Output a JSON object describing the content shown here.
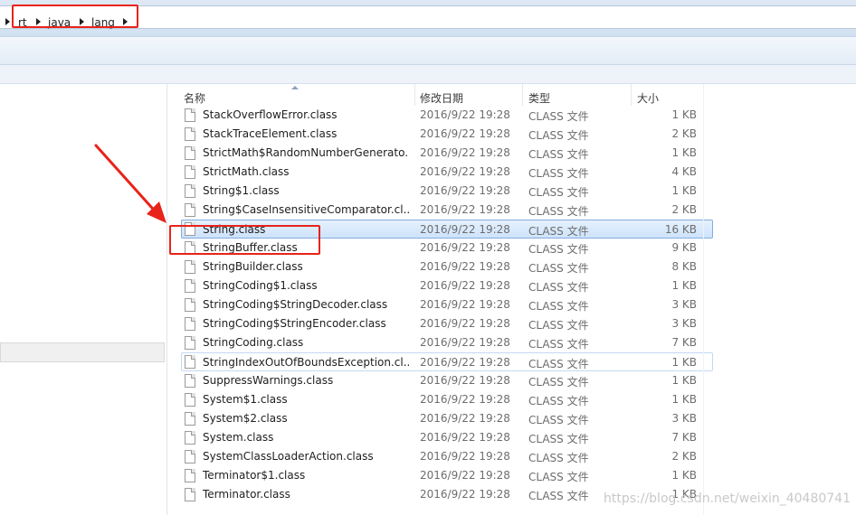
{
  "breadcrumb": [
    "rt",
    "java",
    "lang"
  ],
  "columns": {
    "name": "名称",
    "date": "修改日期",
    "type": "类型",
    "size": "大小"
  },
  "files": [
    {
      "name": "StackOverflowError.class",
      "date": "2016/9/22 19:28",
      "type": "CLASS 文件",
      "size": "1 KB"
    },
    {
      "name": "StackTraceElement.class",
      "date": "2016/9/22 19:28",
      "type": "CLASS 文件",
      "size": "2 KB"
    },
    {
      "name": "StrictMath$RandomNumberGenerato...",
      "date": "2016/9/22 19:28",
      "type": "CLASS 文件",
      "size": "1 KB"
    },
    {
      "name": "StrictMath.class",
      "date": "2016/9/22 19:28",
      "type": "CLASS 文件",
      "size": "4 KB"
    },
    {
      "name": "String$1.class",
      "date": "2016/9/22 19:28",
      "type": "CLASS 文件",
      "size": "1 KB"
    },
    {
      "name": "String$CaseInsensitiveComparator.cl...",
      "date": "2016/9/22 19:28",
      "type": "CLASS 文件",
      "size": "2 KB"
    },
    {
      "name": "String.class",
      "date": "2016/9/22 19:28",
      "type": "CLASS 文件",
      "size": "16 KB",
      "state": "selected"
    },
    {
      "name": "StringBuffer.class",
      "date": "2016/9/22 19:28",
      "type": "CLASS 文件",
      "size": "9 KB"
    },
    {
      "name": "StringBuilder.class",
      "date": "2016/9/22 19:28",
      "type": "CLASS 文件",
      "size": "8 KB"
    },
    {
      "name": "StringCoding$1.class",
      "date": "2016/9/22 19:28",
      "type": "CLASS 文件",
      "size": "1 KB"
    },
    {
      "name": "StringCoding$StringDecoder.class",
      "date": "2016/9/22 19:28",
      "type": "CLASS 文件",
      "size": "3 KB"
    },
    {
      "name": "StringCoding$StringEncoder.class",
      "date": "2016/9/22 19:28",
      "type": "CLASS 文件",
      "size": "3 KB"
    },
    {
      "name": "StringCoding.class",
      "date": "2016/9/22 19:28",
      "type": "CLASS 文件",
      "size": "7 KB"
    },
    {
      "name": "StringIndexOutOfBoundsException.cl...",
      "date": "2016/9/22 19:28",
      "type": "CLASS 文件",
      "size": "1 KB",
      "state": "hovered"
    },
    {
      "name": "SuppressWarnings.class",
      "date": "2016/9/22 19:28",
      "type": "CLASS 文件",
      "size": "1 KB"
    },
    {
      "name": "System$1.class",
      "date": "2016/9/22 19:28",
      "type": "CLASS 文件",
      "size": "1 KB"
    },
    {
      "name": "System$2.class",
      "date": "2016/9/22 19:28",
      "type": "CLASS 文件",
      "size": "3 KB"
    },
    {
      "name": "System.class",
      "date": "2016/9/22 19:28",
      "type": "CLASS 文件",
      "size": "7 KB"
    },
    {
      "name": "SystemClassLoaderAction.class",
      "date": "2016/9/22 19:28",
      "type": "CLASS 文件",
      "size": "2 KB"
    },
    {
      "name": "Terminator$1.class",
      "date": "2016/9/22 19:28",
      "type": "CLASS 文件",
      "size": "1 KB"
    },
    {
      "name": "Terminator.class",
      "date": "2016/9/22 19:28",
      "type": "CLASS 文件",
      "size": "1 KB"
    }
  ],
  "watermark": "https://blog.csdn.net/weixin_40480741",
  "colors": {
    "annotation": "#e8231a",
    "selection": "#cde3fb"
  }
}
